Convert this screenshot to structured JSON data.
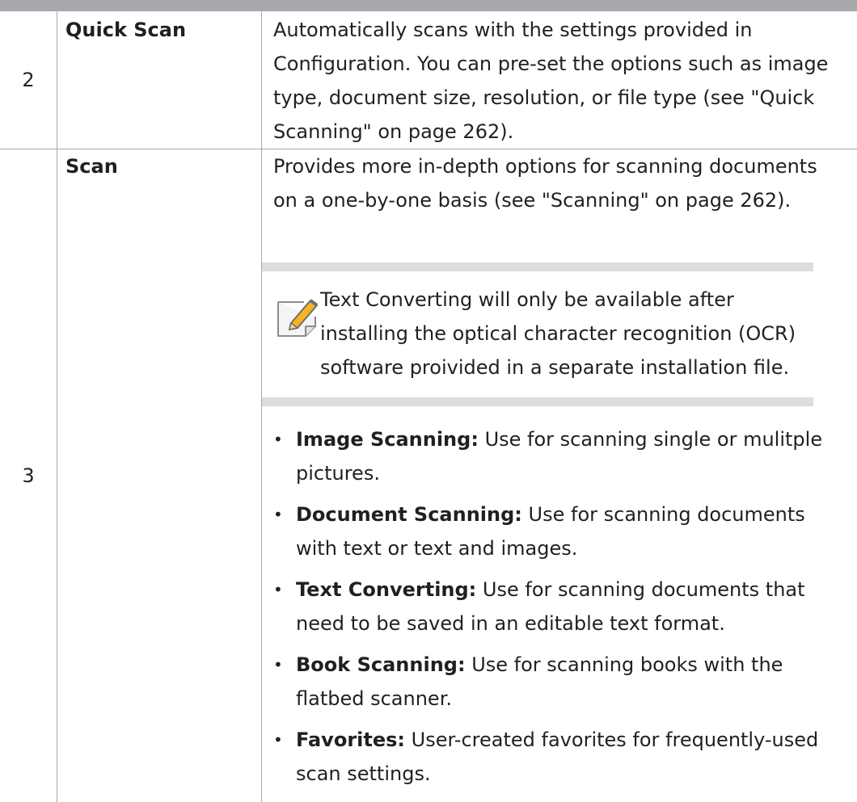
{
  "rows": [
    {
      "number": "2",
      "term": "Quick Scan",
      "description_lines": [
        "Automatically scans with the settings provided in",
        "Configuration. You can pre-set the options such as image",
        "type, document size, resolution, or file type (see \"Quick",
        "Scanning\" on page 262)."
      ]
    },
    {
      "number": "3",
      "term": "Scan",
      "description_lines": [
        "Provides more in-depth options for scanning documents",
        "on a one-by-one basis (see \"Scanning\" on page 262)."
      ],
      "note": {
        "icon": "pencil-note-icon",
        "lines": [
          "Text Converting will only be available after",
          "installing the optical character recognition (OCR)",
          "software proivided in a separate installation file."
        ]
      },
      "bullets": [
        {
          "label": "Image Scanning:",
          "lines": [
            "Use for scanning single or mulitple",
            "pictures."
          ]
        },
        {
          "label": "Document Scanning:",
          "lines": [
            "Use for scanning documents",
            "with text or text and images."
          ]
        },
        {
          "label": "Text Converting:",
          "lines": [
            "Use for scanning documents that",
            "need to be saved in an editable text format."
          ]
        },
        {
          "label": "Book Scanning:",
          "lines": [
            "Use for scanning books with the",
            "flatbed scanner."
          ]
        },
        {
          "label": "Favorites:",
          "lines": [
            "User-created favorites for frequently-used",
            "scan settings."
          ]
        }
      ]
    }
  ],
  "colors": {
    "text": "#231f20",
    "rule": "#a7a9ac",
    "note_band": "#dcddde"
  }
}
